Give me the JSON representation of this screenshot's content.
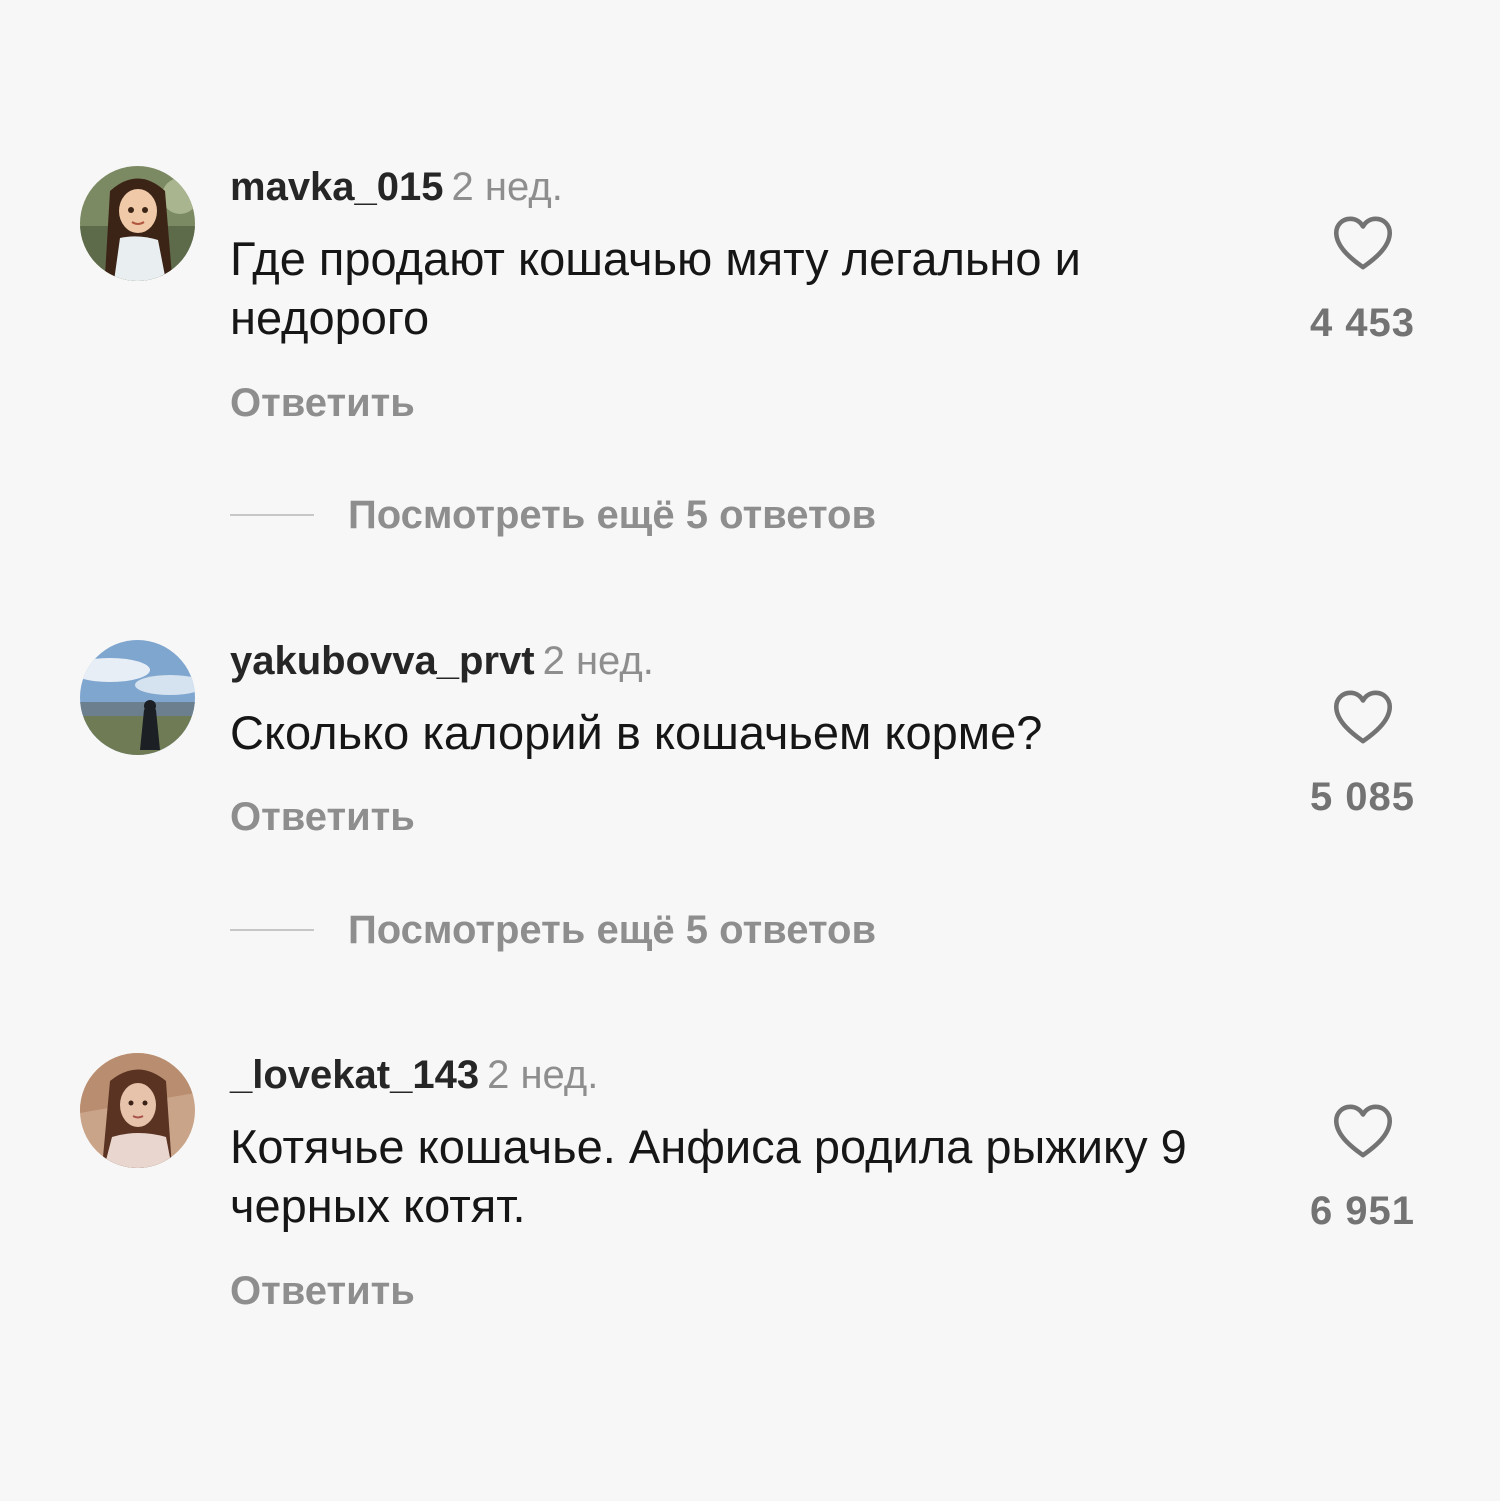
{
  "comments": [
    {
      "username": "mavka_015",
      "time": "2 нед.",
      "text": "Где продают кошачью мяту легально и недорого",
      "reply_label": "Ответить",
      "likes": "4 453",
      "more_replies": "Посмотреть ещё 5 ответов"
    },
    {
      "username": "yakubovva_prvt",
      "time": "2 нед.",
      "text": "Сколько калорий в кошачьем корме?",
      "reply_label": "Ответить",
      "likes": "5 085",
      "more_replies": "Посмотреть ещё 5 ответов"
    },
    {
      "username": "_lovekat_143",
      "time": "2 нед.",
      "text": "Котячье кошачье. Анфиса родила рыжику 9 черных котят.",
      "reply_label": "Ответить",
      "likes": "6 951"
    }
  ],
  "icons": {
    "like": "heart-outline-icon"
  },
  "colors": {
    "background": "#f7f7f7",
    "primary_text": "#262626",
    "secondary_text": "#8e8e8e"
  }
}
